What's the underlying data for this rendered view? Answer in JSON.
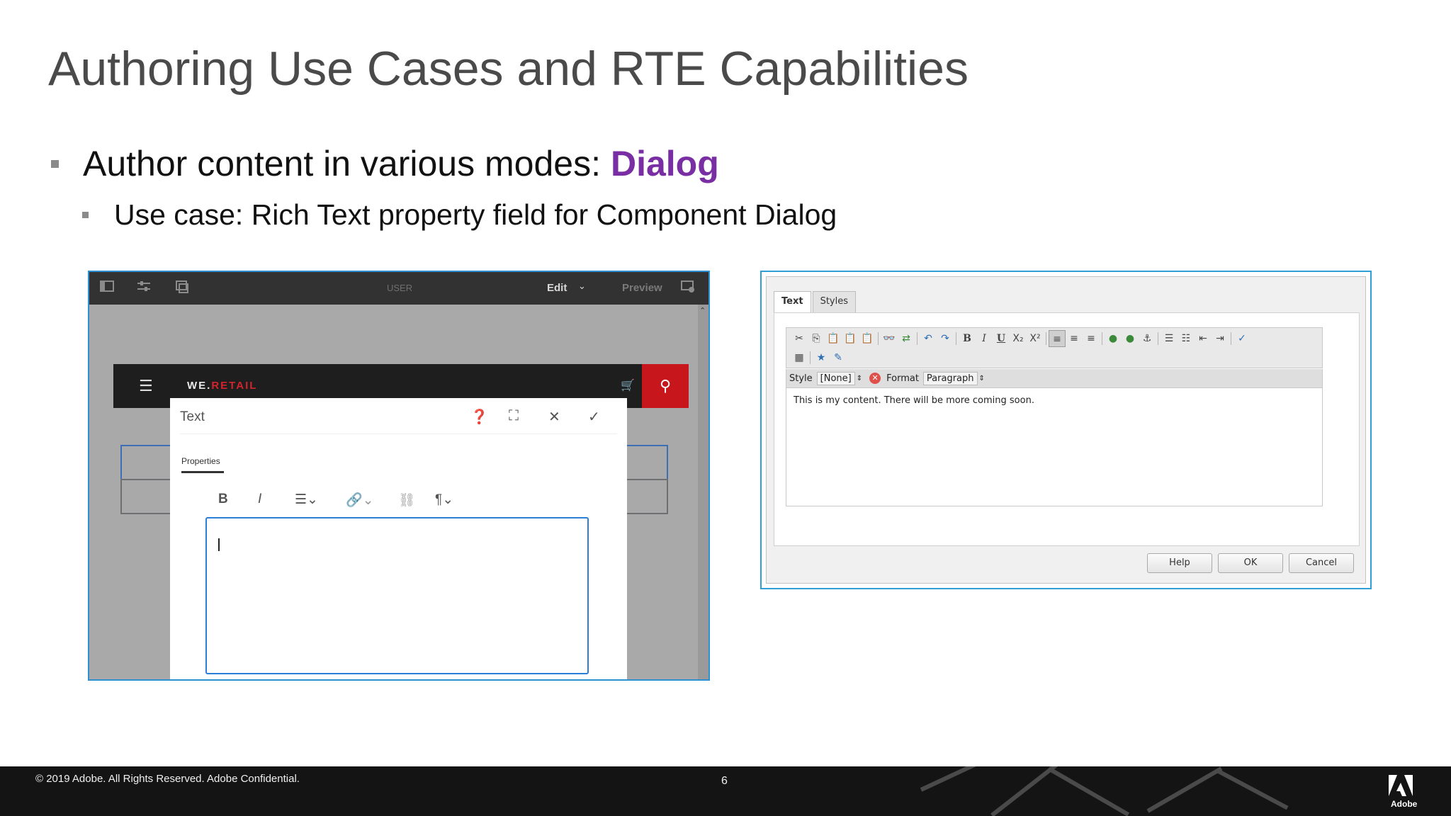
{
  "slide": {
    "title": "Authoring Use Cases and RTE Capabilities",
    "bullet1_text": "Author content in various modes:",
    "bullet1_accent": "Dialog",
    "bullet2_text": "Use case: Rich Text property field for Component Dialog",
    "accent_color": "#7a2ea3"
  },
  "left_screenshot": {
    "topbar": {
      "user_label": "USER",
      "edit_label": "Edit",
      "preview_label": "Preview"
    },
    "site": {
      "logo_we": "WE.",
      "logo_retail": "RETAIL",
      "brand_red": "#d3232d"
    },
    "dialog": {
      "title": "Text",
      "tab_properties": "Properties",
      "editor_value": ""
    }
  },
  "right_screenshot": {
    "tabs": [
      "Text",
      "Styles"
    ],
    "style_label": "Style",
    "style_value": "[None]",
    "format_label": "Format",
    "format_value": "Paragraph",
    "content": "This is my content. There will be more coming soon.",
    "buttons": [
      "Help",
      "OK",
      "Cancel"
    ]
  },
  "footer": {
    "copyright": "© 2019 Adobe.  All Rights Reserved.  Adobe Confidential.",
    "page_number": "6",
    "brand": "Adobe"
  }
}
